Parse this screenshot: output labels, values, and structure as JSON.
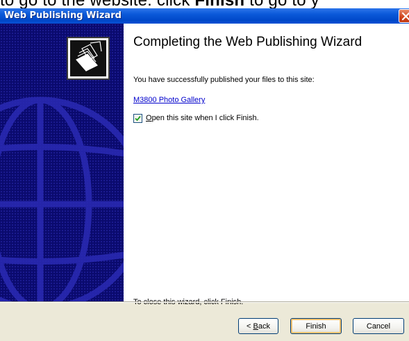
{
  "page_top_text": {
    "before": "to go to the website: click ",
    "bold": "Finish",
    "after": " to go to y"
  },
  "window": {
    "title": "Web Publishing Wizard",
    "close_icon": "close-icon"
  },
  "content": {
    "heading": "Completing the Web Publishing Wizard",
    "success_message": "You have successfully published your files to this site:",
    "site_link": "M3800 Photo Gallery",
    "open_site_checkbox": {
      "checked": true,
      "label_mnemonic": "O",
      "label_rest": "pen this site when I click Finish."
    },
    "close_message": "To close this wizard, click Finish."
  },
  "buttons": {
    "back": {
      "prefix": "< ",
      "mnemonic": "B",
      "rest": "ack"
    },
    "finish": "Finish",
    "cancel": "Cancel"
  },
  "icons": {
    "wizard_icon": "web-publishing-icon",
    "side_graphic": "globe-icon",
    "check_icon": "checkmark-icon"
  },
  "colors": {
    "titlebar": "#0a58d8",
    "side_panel": "#0a0a6e",
    "link": "#0000cc",
    "dialog_bg": "#ece9d8"
  }
}
